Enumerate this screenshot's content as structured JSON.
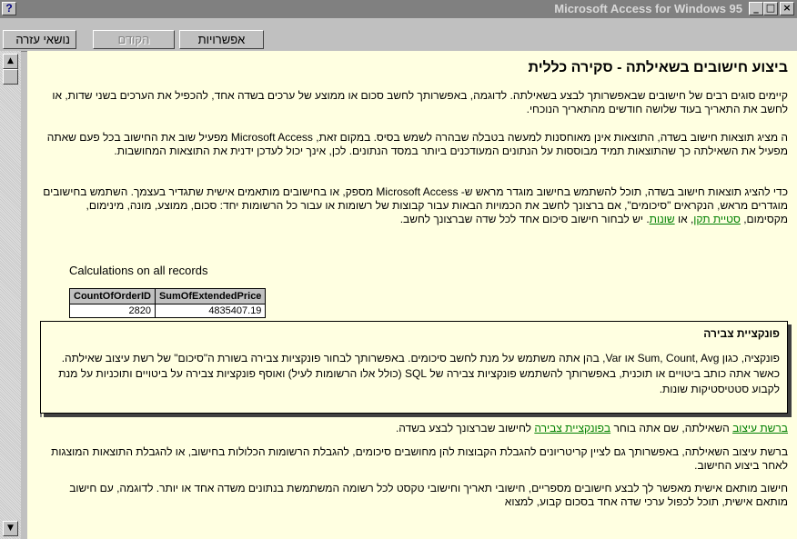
{
  "window": {
    "title": "Microsoft Access for Windows 95",
    "help_glyph": "?",
    "min_glyph": "_",
    "max_glyph": "□",
    "close_glyph": "×"
  },
  "menu": {
    "help_topics": "נושאי עזרה",
    "back": "הקודם",
    "options": "אפשרויות"
  },
  "scroll": {
    "up": "▲",
    "down": "▼"
  },
  "content": {
    "heading": "ביצוע חישובים בשאילתה - סקירה כללית",
    "para1": "קיימים סוגים רבים של חישובים שבאפשרותך לבצע בשאילתה. לדוגמה, באפשרותך לחשב סכום או ממוצע של ערכים בשדה אחד, להכפיל את הערכים בשני שדות, או לחשב את התאריך בעוד שלושה חודשים מהתאריך הנוכחי.",
    "para2": "ה מציג תוצאות חישוב בשדה, התוצאות אינן מאוחסנות למעשה בטבלה שבהרה לשמש בסיס. במקום זאת, Microsoft Access מפעיל שוב את החישוב בכל פעם שאתה מפעיל את השאילתה כך שהתוצאות תמיד מבוססות על הנתונים המעודכנים ביותר במסד הנתונים. לכן, אינך יכול לעדכן ידנית את התוצאות המחושבות.",
    "para3_a": "כדי להציג תוצאות חישוב בשדה, תוכל להשתמש בחישוב מוגדר מראש ש- Microsoft Access מספק, או בחישובים מותאמים אישית שתגדיר בעצמך. השתמש בחישובים מוגדרים מראש, הנקראים \"סיכומים\", אם ברצונך לחשב את הכמויות הבאות עבור קבוצות של רשומות או עבור כל הרשומות יחד: סכום, ממוצע, מונה, מינימום, מקסימום, ",
    "para3_link1": "סטיית תקן",
    "para3_b": ", או ",
    "para3_link2": "שונות",
    "para3_c": ". יש לבחור חישוב סיכום אחד לכל שדה שברצונך לחשב.",
    "calc_label": "Calculations on all records",
    "table": {
      "headers": [
        "CountOfOrderID",
        "SumOfExtendedPrice"
      ],
      "row": [
        "2820",
        "4835407.19"
      ]
    },
    "para4_link1": "ברשת עיצוב",
    "para4_a": " השאילתה, שם אתה בוחר ",
    "para4_link2": "בפונקציית צבירה",
    "para4_b": " לחישוב שברצונך לבצע בשדה.",
    "para5": "ברשת עיצוב השאילתה, באפשרותך גם לציין קריטריונים להגבלת הקבוצות להן מחושבים סיכומים, להגבלת הרשומות הכלולות בחישוב, או להגבלת התוצאות המוצגות לאחר ביצוע החישוב.",
    "para6": "חישוב מותאם אישית מאפשר לך לבצע חישובים מספריים, חישובי תאריך וחישובי טקסט לכל רשומה המשתמשת בנתונים משדה אחד או יותר. לדוגמה, עם חישוב מותאם אישית, תוכל לכפול ערכי שדה אחד בסכום קבוע, למצוא"
  },
  "popup": {
    "title": "פונקציית צבירה",
    "text": "פונקציה, כגון Sum, Count, Avg או Var, בהן אתה משתמש על מנת לחשב סיכומים. באפשרותך לבחור פונקציות צבירה בשורת ה\"סיכום\" של רשת עיצוב שאילתה. כאשר אתה כותב ביטויים או תוכנית, באפשרותך להשתמש פונקציות צבירה של SQL (כולל אלו הרשומות לעיל) ואוסף פונקציות צבירה על ביטויים ותוכניות על מנת לקבוע סטטיסטיקות שונות."
  }
}
